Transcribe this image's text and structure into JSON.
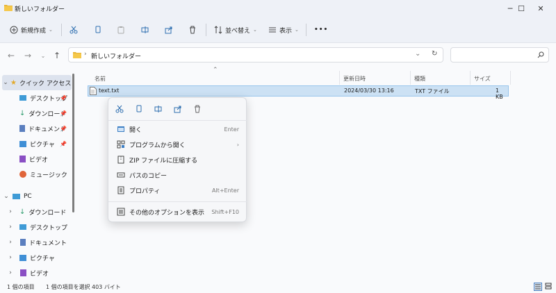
{
  "window": {
    "title": "新しいフォルダー",
    "minimize": "─",
    "maximize": "☐",
    "close": "✕"
  },
  "toolbar": {
    "new_label": "新規作成",
    "sort_label": "並べ替え",
    "view_label": "表示",
    "more_label": "•••"
  },
  "address": {
    "path": "新しいフォルダー"
  },
  "sidebar": {
    "quick_access": "クイック アクセス",
    "quick_items": [
      {
        "label": "デスクトップ"
      },
      {
        "label": "ダウンロード"
      },
      {
        "label": "ドキュメント"
      },
      {
        "label": "ピクチャ"
      },
      {
        "label": "ビデオ"
      },
      {
        "label": "ミュージック"
      }
    ],
    "pc": "PC",
    "pc_items": [
      {
        "label": "ダウンロード"
      },
      {
        "label": "デスクトップ"
      },
      {
        "label": "ドキュメント"
      },
      {
        "label": "ピクチャ"
      },
      {
        "label": "ビデオ"
      }
    ]
  },
  "columns": {
    "name": "名前",
    "modified": "更新日時",
    "type": "種類",
    "size": "サイズ"
  },
  "files": [
    {
      "name": "text.txt",
      "modified": "2024/03/30 13:16",
      "type": "TXT ファイル",
      "size": "1 KB"
    }
  ],
  "context_menu": {
    "items": [
      {
        "label": "開く",
        "shortcut": "Enter"
      },
      {
        "label": "プログラムから開く",
        "shortcut": "›"
      },
      {
        "label": "ZIP ファイルに圧縮する",
        "shortcut": ""
      },
      {
        "label": "パスのコピー",
        "shortcut": ""
      },
      {
        "label": "プロパティ",
        "shortcut": "Alt+Enter"
      }
    ],
    "more_options": {
      "label": "その他のオプションを表示",
      "shortcut": "Shift+F10"
    }
  },
  "status": {
    "count": "1 個の項目",
    "selected": "1 個の項目を選択",
    "size": "403 バイト"
  }
}
